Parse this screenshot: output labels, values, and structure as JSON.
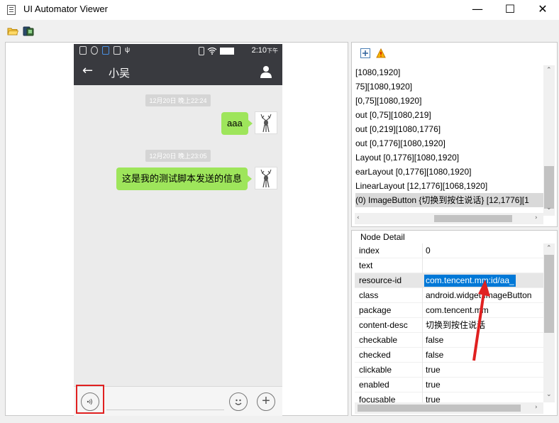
{
  "window": {
    "title": "UI Automator Viewer",
    "minimize": "—",
    "maximize": "☐",
    "close": "✕"
  },
  "toolbar": {
    "open_icon": "folder-open-icon",
    "screenshot_icon": "device-screenshot-icon"
  },
  "phone": {
    "status_time": "2:10",
    "status_ampm": "下午",
    "chat_name": "小吴",
    "messages": [
      {
        "timestamp": "12月20日 晚上22:24",
        "text": "aaa"
      },
      {
        "timestamp": "12月20日 晚上23:05",
        "text": "这是我的测试脚本发送的信息"
      }
    ]
  },
  "tree": {
    "expand_icon": "expand-all-icon",
    "warning_icon": "warning-icon",
    "rows": [
      "[1080,1920]",
      "75][1080,1920]",
      " [0,75][1080,1920]",
      "out [0,75][1080,219]",
      "out [0,219][1080,1776]",
      "out [0,1776][1080,1920]",
      "Layout [0,1776][1080,1920]",
      "earLayout [0,1776][1080,1920]",
      " LinearLayout [12,1776][1068,1920]",
      "(0) ImageButton {切换到按住说话} [12,1776][1"
    ],
    "selected_index": 9
  },
  "detail": {
    "legend": "Node Detail",
    "rows": [
      {
        "key": "index",
        "value": "0"
      },
      {
        "key": "text",
        "value": ""
      },
      {
        "key": "resource-id",
        "value": "com.tencent.mm:id/aa_"
      },
      {
        "key": "class",
        "value": "android.widget.ImageButton"
      },
      {
        "key": "package",
        "value": "com.tencent.mm"
      },
      {
        "key": "content-desc",
        "value": "切换到按住说话"
      },
      {
        "key": "checkable",
        "value": "false"
      },
      {
        "key": "checked",
        "value": "false"
      },
      {
        "key": "clickable",
        "value": "true"
      },
      {
        "key": "enabled",
        "value": "true"
      },
      {
        "key": "focusable",
        "value": "true"
      }
    ]
  },
  "colors": {
    "bubble": "#9ee55b",
    "phone_header": "#393a3f",
    "highlight": "#0078d7",
    "annotation_red": "#e02020"
  }
}
